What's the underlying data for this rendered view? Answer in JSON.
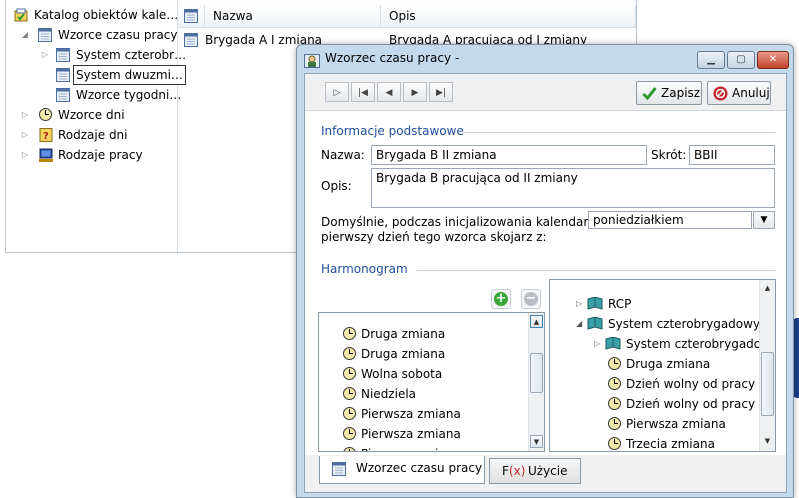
{
  "tree": {
    "items": [
      {
        "label": "Katalog obiektów kale…",
        "arrow": ""
      },
      {
        "label": "Wzorce czasu pracy",
        "arrow": "▲"
      },
      {
        "label": "System czterobr…",
        "arrow": "▷"
      },
      {
        "label": "System dwuzmi…",
        "arrow": ""
      },
      {
        "label": "Wzorce tygodni…",
        "arrow": ""
      },
      {
        "label": "Wzorce dni",
        "arrow": "▷"
      },
      {
        "label": "Rodzaje dni",
        "arrow": "▷"
      },
      {
        "label": "Rodzaje pracy",
        "arrow": "▷"
      }
    ]
  },
  "list": {
    "columns": [
      "Nazwa",
      "Opis"
    ],
    "rows": [
      {
        "nazwa": "Brygada A I zmiana",
        "opis": "Brygada A pracująca od I zmiany"
      }
    ]
  },
  "dialog": {
    "title": "Wzorzec czasu pracy -",
    "save_label": "Zapisz",
    "cancel_label": "Anuluj",
    "section_basic": "Informacje podstawowe",
    "name_label": "Nazwa:",
    "name_value": "Brygada B II zmiana",
    "short_label": "Skrót:",
    "short_value": "BBII",
    "desc_label": "Opis:",
    "desc_value": "Brygada B pracująca od II zmiany",
    "default_label_1": "Domyślnie, podczas inicjalizowania kalendarza,",
    "default_label_2": "pierwszy dzień tego wzorca skojarz z:",
    "default_value": "poniedziałkiem",
    "section_schedule": "Harmonogram",
    "schedule_items": [
      "Druga zmiana",
      "Druga zmiana",
      "Wolna sobota",
      "Niedziela",
      "Pierwsza zmiana",
      "Pierwsza zmiana",
      "Pierwsza zmiana"
    ],
    "catalog_items": [
      {
        "label": "RCP",
        "type": "book",
        "arrow": "▷"
      },
      {
        "label": "System czterobrygadowy",
        "type": "book",
        "arrow": "◢"
      },
      {
        "label": "System czterobrygadowy",
        "type": "book",
        "arrow": "▷"
      },
      {
        "label": "Druga zmiana",
        "type": "clock",
        "arrow": ""
      },
      {
        "label": "Dzień wolny od pracy",
        "type": "clock",
        "arrow": ""
      },
      {
        "label": "Dzień wolny od pracy be",
        "type": "clock",
        "arrow": ""
      },
      {
        "label": "Pierwsza zmiana",
        "type": "clock",
        "arrow": ""
      },
      {
        "label": "Trzecia zmiana",
        "type": "clock",
        "arrow": ""
      }
    ],
    "tabs": [
      {
        "label": "Wzorzec czasu pracy"
      },
      {
        "label": "Użycie"
      }
    ]
  },
  "colors": {
    "section_title": "#1f4e9a",
    "dialog_frame": "#c5d9ec",
    "add_green": "#3aa63a",
    "remove_gray": "#b9bec4",
    "save_green": "#2e9a2e",
    "cancel_red": "#c2262b"
  }
}
